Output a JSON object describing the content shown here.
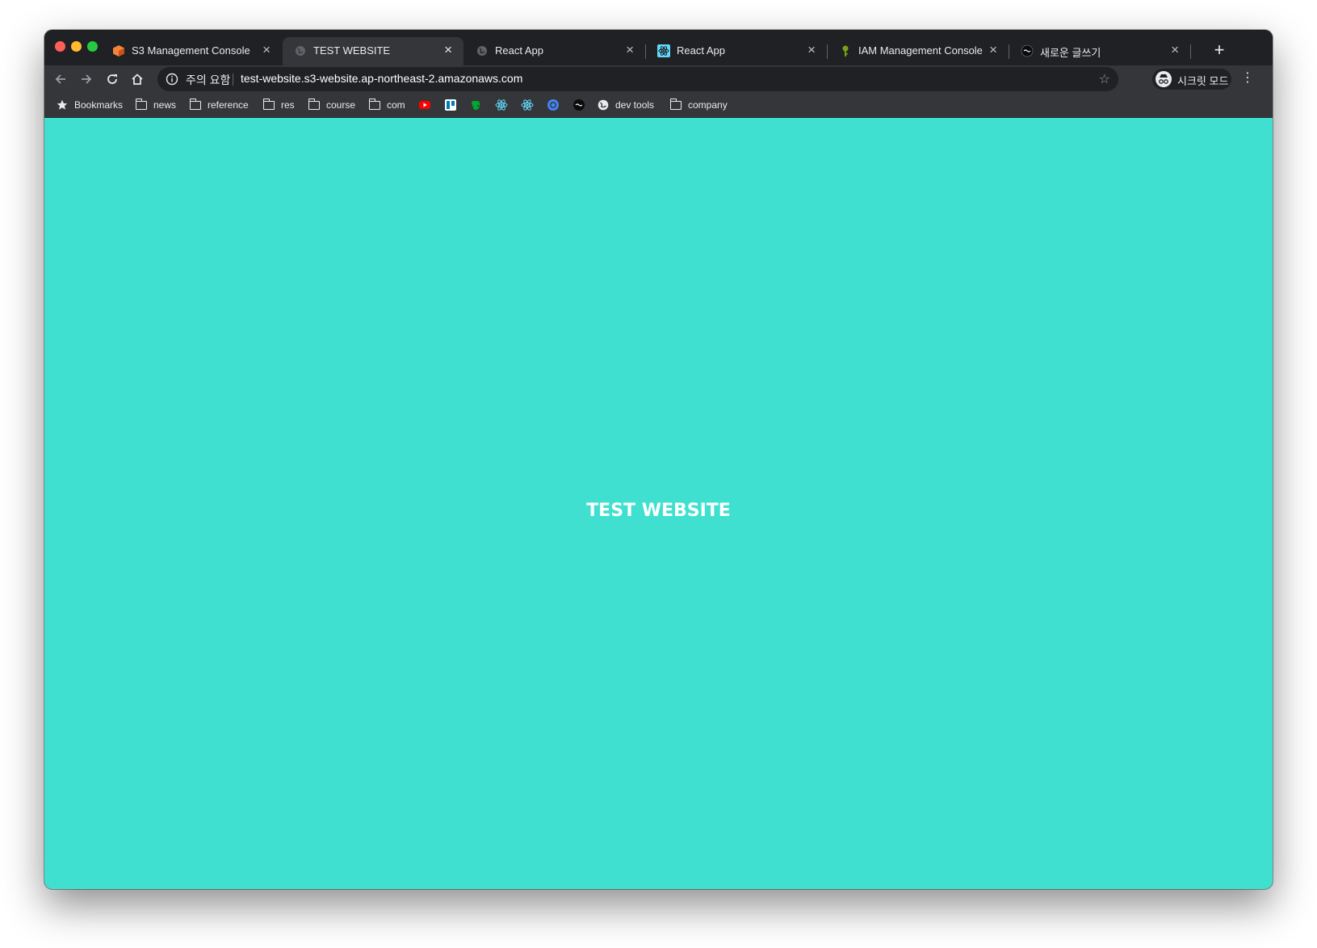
{
  "browser": {
    "tabs": [
      {
        "title": "S3 Management Console",
        "favicon": "aws-s3-icon",
        "active": false
      },
      {
        "title": "TEST WEBSITE",
        "favicon": "globe-icon",
        "active": true
      },
      {
        "title": "React App",
        "favicon": "globe-icon",
        "active": false
      },
      {
        "title": "React App",
        "favicon": "react-icon",
        "active": false
      },
      {
        "title": "IAM Management Console",
        "favicon": "aws-iam-icon",
        "active": false
      },
      {
        "title": "새로운 글쓰기",
        "favicon": "velog-icon",
        "active": false
      }
    ],
    "new_tab_symbol": "+",
    "close_symbol": "×",
    "omnibox": {
      "security_label": "주의 요함",
      "url": "test-website.s3-website.ap-northeast-2.amazonaws.com"
    },
    "profile_label": "시크릿 모드",
    "bookmarks": {
      "star_label": "Bookmarks",
      "folders": [
        "news",
        "reference",
        "res",
        "course",
        "com"
      ],
      "icon_bookmarks": [
        "youtube-icon",
        "trello-icon",
        "evernote-icon",
        "react-icon",
        "react-icon",
        "chrome-devtools-icon",
        "velog-icon"
      ],
      "dev_tools": "dev tools",
      "company": "company"
    }
  },
  "page": {
    "heading": "TEST WEBSITE",
    "background": "#40e0d0"
  },
  "colors": {
    "chrome_dark": "#202124",
    "chrome_toolbar": "#35363a",
    "aws_orange": "#ff9900"
  }
}
